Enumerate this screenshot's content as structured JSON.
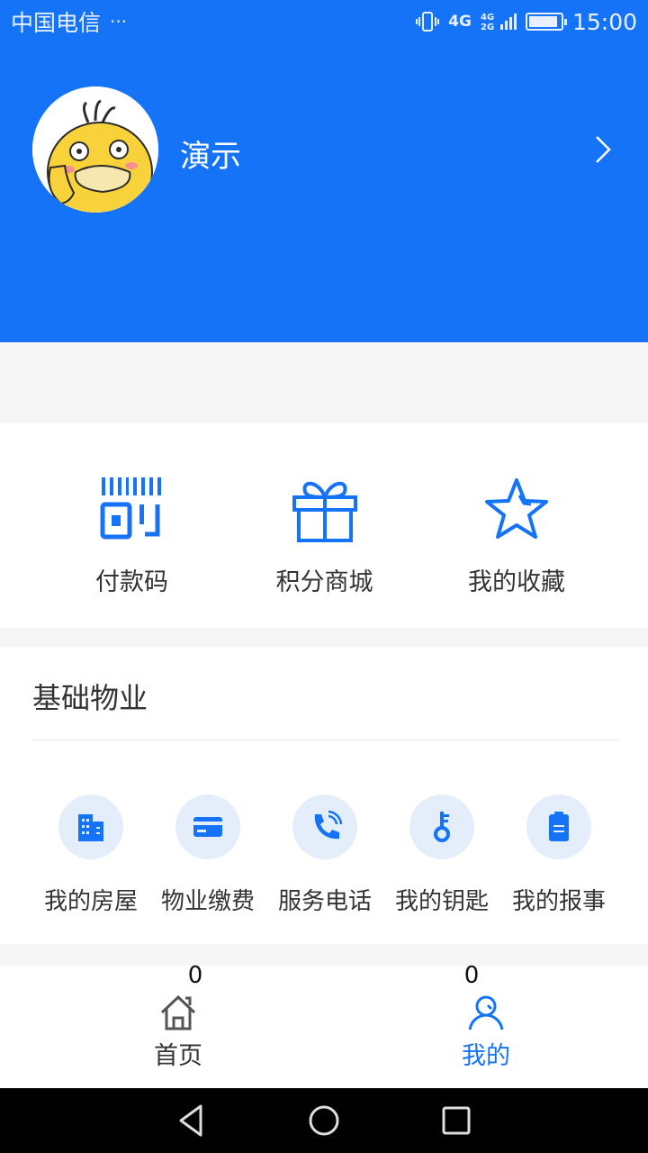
{
  "status_bar": {
    "carrier": "中国电信",
    "more": "···",
    "network": "4G",
    "time": "15:00",
    "battery_level": 0.9
  },
  "profile": {
    "name": "演示",
    "avatar_icon": "duck-avatar-icon",
    "arrow_icon": "chevron-right-icon"
  },
  "quick_actions": [
    {
      "label": "付款码",
      "icon": "payment-code-icon"
    },
    {
      "label": "积分商城",
      "icon": "gift-icon"
    },
    {
      "label": "我的收藏",
      "icon": "star-icon"
    }
  ],
  "basic_property": {
    "title": "基础物业",
    "items": [
      {
        "label": "我的房屋",
        "icon": "building-icon"
      },
      {
        "label": "物业缴费",
        "icon": "card-icon"
      },
      {
        "label": "服务电话",
        "icon": "phone-icon"
      },
      {
        "label": "我的钥匙",
        "icon": "key-icon"
      },
      {
        "label": "我的报事",
        "icon": "clipboard-icon"
      }
    ]
  },
  "tabs": [
    {
      "label": "首页",
      "badge": "0",
      "icon": "home-icon",
      "active": false
    },
    {
      "label": "我的",
      "badge": "0",
      "icon": "person-icon",
      "active": true
    }
  ],
  "colors": {
    "brand": "#1473f7",
    "icon_bg": "#e4eefb"
  }
}
